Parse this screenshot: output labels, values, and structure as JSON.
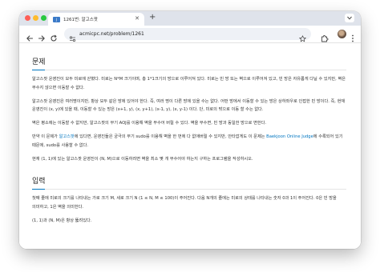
{
  "browser": {
    "tab_title": "1261번: 알고스팟",
    "tab_favicon": "J",
    "url": "acmicpc.net/problem/1261"
  },
  "problem": {
    "section1_title": "문제",
    "para1": "알고스팟 운영진이 모두 미로에 갇혔다. 미로는 N*M 크기이며, 총 1*1크기의 방으로 이루어져 있다. 미로는 빈 방 또는 벽으로 이루어져 있고, 빈 방은 자유롭게 다닐 수 있지만, 벽은 부수지 않으면 이동할 수 없다.",
    "para2": "알고스팟 운영진은 여러명이지만, 항상 모두 같은 방에 있어야 한다. 즉, 여러 명이 다른 방에 있을 수는 없다. 어떤 방에서 이동할 수 있는 방은 상하좌우로 인접한 빈 방이다. 즉, 현재 운영진이 (x, y)에 있을 때, 이동할 수 있는 방은 (x+1, y), (x, y+1), (x-1, y), (x, y-1) 이다. 단, 미로의 밖으로 이동 할 수는 없다.",
    "para3": "벽은 평소에는 이동할 수 없지만, 알고스팟의 무기 AOJ를 이용해 벽을 부수어 버릴 수 있다. 벽을 부수면, 빈 방과 동일한 방으로 변한다.",
    "para4_before": "만약 이 문제가 ",
    "para4_link1": "알고스팟",
    "para4_mid": "에 있다면, 운영진들은 궁극의 무기 sudo를 이용해 벽을 한 번에 다 없애버릴 수 있지만, 안타깝게도 이 문제는 ",
    "para4_link2": "Baekjoon Online Judge",
    "para4_after": "에 수록되어 있기 때문에, sudo를 사용할 수 없다.",
    "para5": "현재 (1, 1)에 있는 알고스팟 운영진이 (N, M)으로 이동하려면 벽을 최소 몇 개 부수어야 하는지 구하는 프로그램을 작성하시오.",
    "section2_title": "입력",
    "input1": "첫째 줄에 미로의 크기를 나타내는 가로 크기 M, 세로 크기 N (1 ≤ N, M ≤ 100)이 주어진다. 다음 N개의 줄에는 미로의 상태를 나타내는 숫자 0과 1이 주어진다. 0은 빈 방을 의미하고, 1은 벽을 의미한다.",
    "input2": "(1, 1)과 (N, M)은 항상 뚫려있다."
  },
  "icons": {
    "back": "back-arrow-icon",
    "forward": "forward-arrow-icon",
    "reload": "reload-icon",
    "site_info": "site-info-icon",
    "bookmark": "star-icon",
    "extensions": "puzzle-icon",
    "menu": "kebab-menu-icon"
  },
  "colors": {
    "link": "#0076c0",
    "tabstrip": "#dfe3eb",
    "omnibox": "#eef1f6"
  }
}
